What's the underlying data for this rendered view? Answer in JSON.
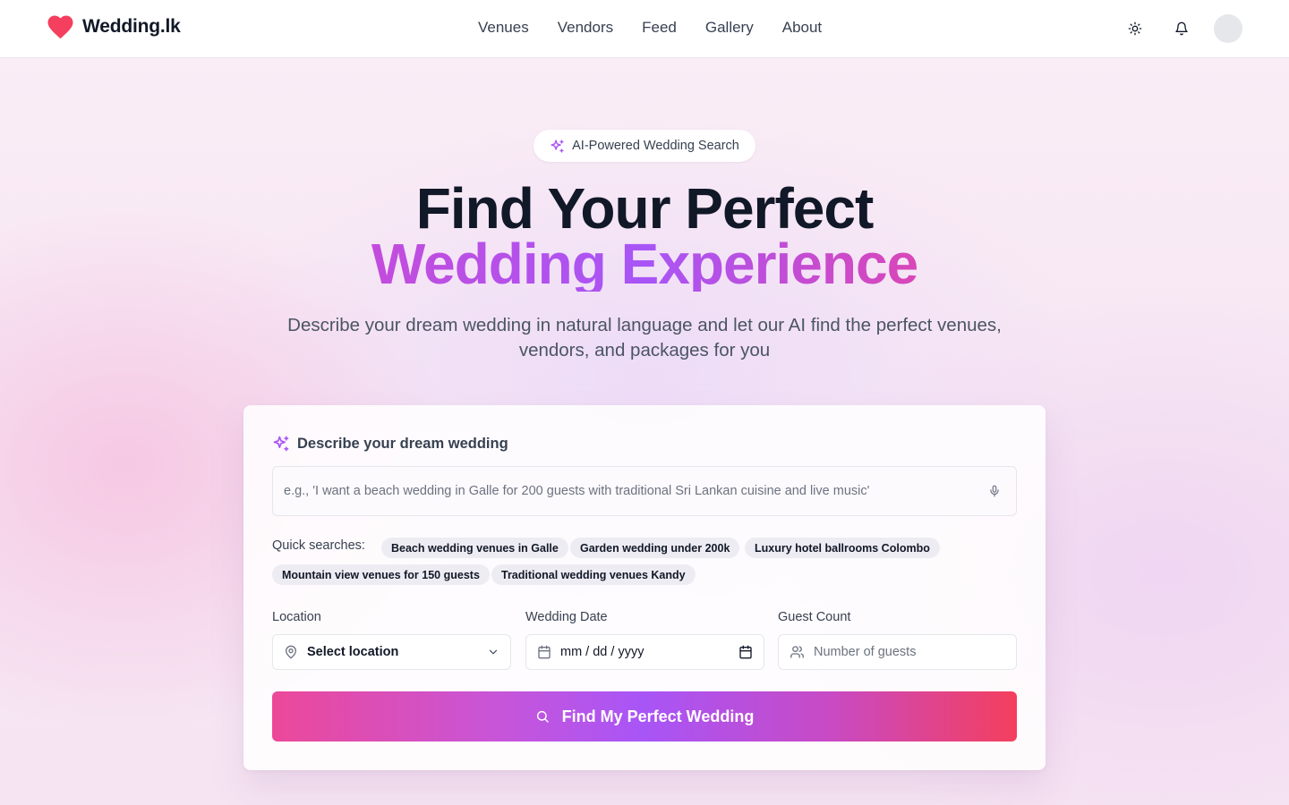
{
  "brand": {
    "name": "Wedding.lk",
    "icon": "heart-icon",
    "icon_color": "#f43f5e"
  },
  "nav": {
    "links": [
      "Venues",
      "Vendors",
      "Feed",
      "Gallery",
      "About"
    ],
    "theme_icon": "sun-icon",
    "notification_icon": "bell-icon"
  },
  "hero": {
    "badge": "AI-Powered Wedding Search",
    "title_line1": "Find Your Perfect",
    "title_line2": "Wedding Experience",
    "subtitle": "Describe your dream wedding in natural language and let our AI find the perfect venues, vendors, and packages for you"
  },
  "search": {
    "title": "Describe your dream wedding",
    "prompt_placeholder": "e.g., 'I want a beach wedding in Galle for 200 guests with traditional Sri Lankan cuisine and live music'",
    "quick_label": "Quick searches:",
    "quick_searches": [
      "Beach wedding venues in Galle",
      "Garden wedding under 200k",
      "Luxury hotel ballrooms Colombo",
      "Mountain view venues for 150 guests",
      "Traditional wedding venues Kandy"
    ],
    "location": {
      "label": "Location",
      "value": "Select location"
    },
    "date": {
      "label": "Wedding Date",
      "value": "mm / dd / yyyy"
    },
    "guests": {
      "label": "Guest Count",
      "placeholder": "Number of guests"
    },
    "submit_label": "Find My Perfect Wedding"
  },
  "colors": {
    "accent_purple": "#a855f7",
    "accent_pink": "#ec4899",
    "accent_rose": "#f43f5e"
  }
}
